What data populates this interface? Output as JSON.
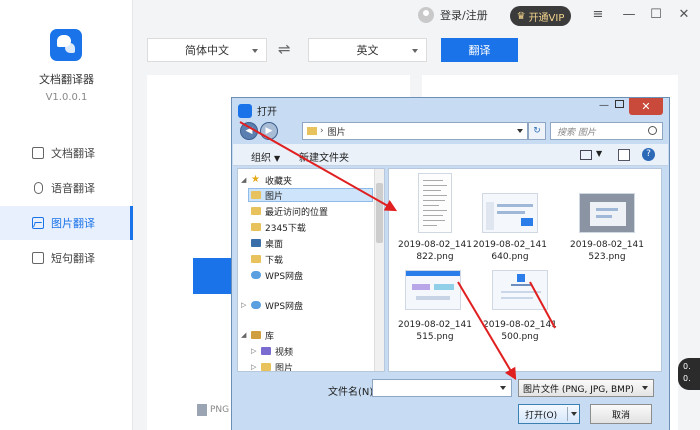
{
  "app": {
    "name": "文档翻译器",
    "version": "V1.0.0.1"
  },
  "sidebar": {
    "items": [
      {
        "label": "文档翻译",
        "icon": "document-icon"
      },
      {
        "label": "语音翻译",
        "icon": "microphone-icon"
      },
      {
        "label": "图片翻译",
        "icon": "image-icon",
        "active": true
      },
      {
        "label": "短句翻译",
        "icon": "text-icon"
      }
    ]
  },
  "topbar": {
    "login_label": "登录/注册",
    "vip_label": "开通VIP",
    "window_controls": {
      "menu": "≡",
      "minimize": "—",
      "maximize": "☐",
      "close": "✕"
    }
  },
  "translate_bar": {
    "source_lang": "简体中文",
    "swap_icon": "⇌",
    "target_lang": "英文",
    "translate_button": "翻译"
  },
  "main": {
    "file_type_hint": "PNG"
  },
  "side_badge": {
    "line1": "0.",
    "line2": "0."
  },
  "dialog": {
    "title": "打开",
    "close": "✕",
    "address": {
      "path": "图片"
    },
    "search_placeholder": "搜索 图片",
    "toolbar": {
      "organize": "组织",
      "new_folder": "新建文件夹",
      "help": "?"
    },
    "tree": [
      {
        "label": "收藏夹",
        "icon": "star-icon",
        "expander": "◢"
      },
      {
        "label": "图片",
        "icon": "folder-icon",
        "selected": true
      },
      {
        "label": "最近访问的位置",
        "icon": "folder-icon"
      },
      {
        "label": "2345下载",
        "icon": "folder-icon"
      },
      {
        "label": "桌面",
        "icon": "desktop-icon"
      },
      {
        "label": "下载",
        "icon": "folder-icon"
      },
      {
        "label": "WPS网盘",
        "icon": "cloud-icon"
      },
      {
        "label": "WPS网盘",
        "icon": "cloud-icon",
        "expander": "▷"
      },
      {
        "label": "库",
        "icon": "library-icon",
        "expander": "◢"
      },
      {
        "label": "视频",
        "icon": "video-icon",
        "expander": "▷"
      },
      {
        "label": "图片",
        "icon": "folder-icon",
        "expander": "▷"
      }
    ],
    "files": [
      {
        "line1": "2019-08-02_141",
        "line2": "822.png"
      },
      {
        "line1": "2019-08-02_141",
        "line2": "640.png"
      },
      {
        "line1": "2019-08-02_141",
        "line2": "523.png"
      },
      {
        "line1": "2019-08-02_141",
        "line2": "515.png"
      },
      {
        "line1": "2019-08-02_141",
        "line2": "500.png"
      }
    ],
    "filename_label": "文件名(N):",
    "filename_value": "",
    "filetype_value": "图片文件 (PNG, JPG, BMP)",
    "open_button": "打开(O)",
    "cancel_button": "取消"
  },
  "colors": {
    "accent": "#1a73e8",
    "arrow": "#e02020",
    "vip_bg": "#3b3b3b",
    "vip_text": "#f2d48c"
  }
}
